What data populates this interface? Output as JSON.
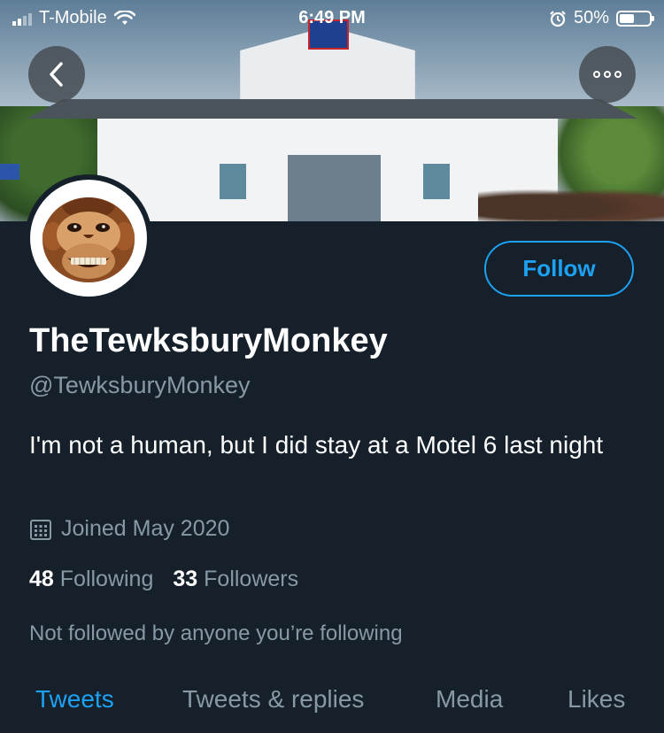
{
  "status_bar": {
    "carrier": "T-Mobile",
    "time": "6:49 PM",
    "battery": "50%",
    "battery_level": 0.5
  },
  "profile": {
    "display_name": "TheTewksburyMonkey",
    "handle": "@TewksburyMonkey",
    "bio": "I'm not a human, but I did stay at a Motel 6 last night",
    "joined": "Joined May 2020",
    "following_count": "48",
    "following_label": "Following",
    "followers_count": "33",
    "followers_label": "Followers",
    "not_followed_note": "Not followed by anyone you’re following"
  },
  "actions": {
    "follow_label": "Follow"
  },
  "tabs": [
    {
      "label": "Tweets",
      "active": true
    },
    {
      "label": "Tweets & replies",
      "active": false
    },
    {
      "label": "Media",
      "active": false
    },
    {
      "label": "Likes",
      "active": false
    }
  ],
  "colors": {
    "background": "#15202b",
    "accent": "#1da1f2",
    "secondary_text": "#8899a6"
  },
  "icons": [
    "chevron-left-icon",
    "more-icon",
    "calendar-icon",
    "wifi-icon",
    "alarm-icon",
    "battery-icon",
    "signal-icon"
  ]
}
